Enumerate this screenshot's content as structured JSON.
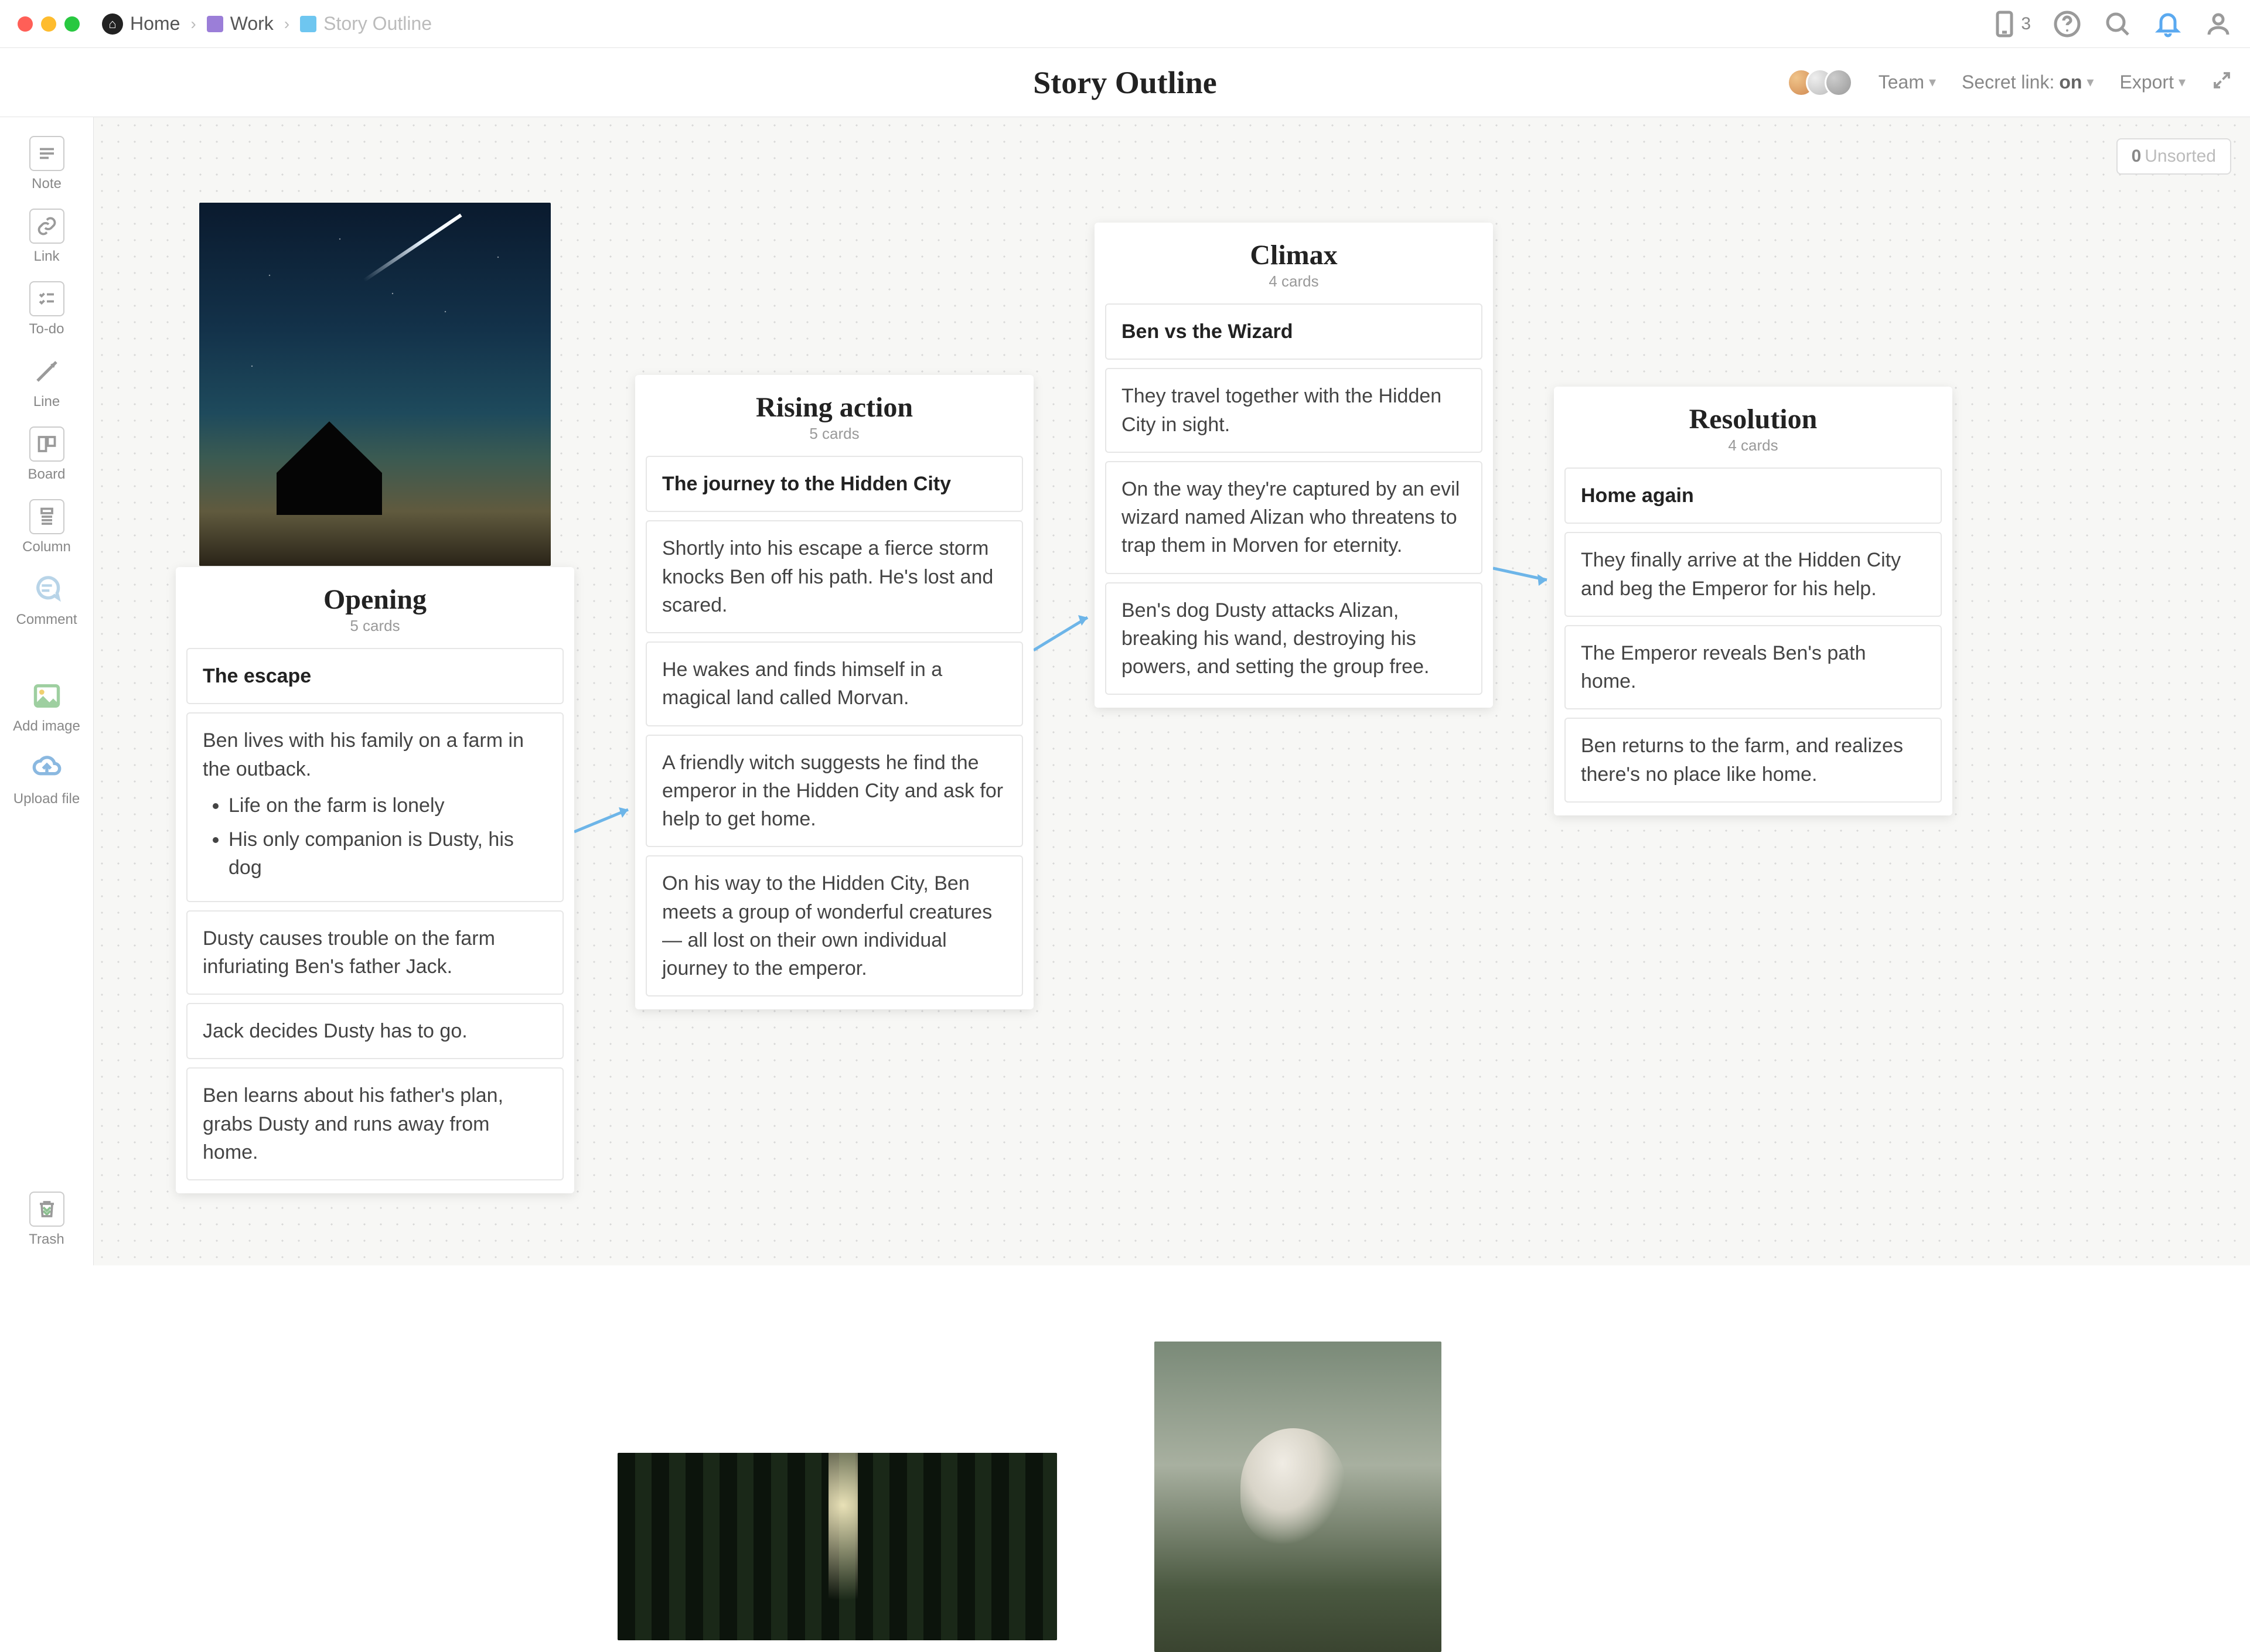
{
  "breadcrumb": {
    "home": "Home",
    "work": "Work",
    "current": "Story Outline"
  },
  "deviceCount": "3",
  "page": {
    "title": "Story Outline"
  },
  "toolbar": {
    "team": "Team",
    "secretLabel": "Secret link:",
    "secretState": "on",
    "export": "Export"
  },
  "sidebar": {
    "items": [
      {
        "label": "Note"
      },
      {
        "label": "Link"
      },
      {
        "label": "To-do"
      },
      {
        "label": "Line"
      },
      {
        "label": "Board"
      },
      {
        "label": "Column"
      },
      {
        "label": "Comment"
      },
      {
        "label": "Add image"
      },
      {
        "label": "Upload file"
      }
    ],
    "trash": "Trash"
  },
  "unsorted": {
    "count": "0",
    "label": "Unsorted"
  },
  "columns": {
    "opening": {
      "title": "Opening",
      "sub": "5 cards",
      "cards": [
        {
          "text": "The escape",
          "bold": true
        },
        {
          "text": "Ben lives with his family on a farm in the outback.",
          "bullets": [
            "Life on the farm is lonely",
            "His only companion is Dusty, his dog"
          ]
        },
        {
          "text": "Dusty causes trouble on the farm infuriating Ben's father Jack."
        },
        {
          "text": "Jack decides Dusty has to go."
        },
        {
          "text": "Ben learns about his father's plan, grabs Dusty and runs away from home."
        }
      ]
    },
    "rising": {
      "title": "Rising action",
      "sub": "5 cards",
      "cards": [
        {
          "text": "The journey to the Hidden City",
          "bold": true
        },
        {
          "text": "Shortly into his escape a fierce storm knocks Ben off his path. He's lost and scared."
        },
        {
          "text": "He wakes and finds himself in a magical land called Morvan."
        },
        {
          "text": "A friendly witch suggests he find the emperor in the Hidden City and ask for help to get home."
        },
        {
          "text": "On his way to the Hidden City, Ben meets a group of wonderful creatures — all lost on their own individual journey to the emperor."
        }
      ]
    },
    "climax": {
      "title": "Climax",
      "sub": "4 cards",
      "cards": [
        {
          "text": "Ben vs the Wizard",
          "bold": true
        },
        {
          "text": "They travel together with the Hidden City in sight."
        },
        {
          "text": "On the way they're captured by an evil wizard named Alizan who threatens to trap them in Morven for eternity."
        },
        {
          "text": "Ben's dog Dusty attacks Alizan, breaking his wand, destroying his powers, and setting the group free."
        }
      ]
    },
    "resolution": {
      "title": "Resolution",
      "sub": "4 cards",
      "cards": [
        {
          "text": "Home again",
          "bold": true
        },
        {
          "text": "They finally arrive at the Hidden City and beg the Emperor for his help."
        },
        {
          "text": "The Emperor reveals Ben's path home."
        },
        {
          "text": "Ben returns to the farm, and realizes there's no place like home."
        }
      ]
    }
  }
}
